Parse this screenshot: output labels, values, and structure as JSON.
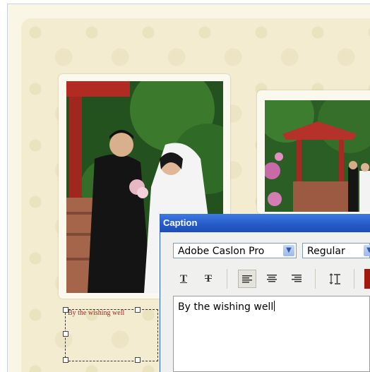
{
  "caption_dialog": {
    "title": "Caption",
    "font_family_value": "Adobe Caslon Pro",
    "font_style_value": "Regular",
    "toolbar": {
      "underline_icon": "T",
      "strikethrough_icon": "T",
      "align_left_icon": "align-left",
      "align_center_icon": "align-center",
      "align_right_icon": "align-right",
      "text_spacing_icon": "text-spacing",
      "text_color": "#a3180e"
    },
    "caption_text": "By the wishing well"
  },
  "page": {
    "caption_box_text": "By the wishing well"
  },
  "colors": {
    "title_bar": "#2459c6",
    "page_background": "#f3ecd1",
    "caption_text_color": "#9a2a1f"
  }
}
